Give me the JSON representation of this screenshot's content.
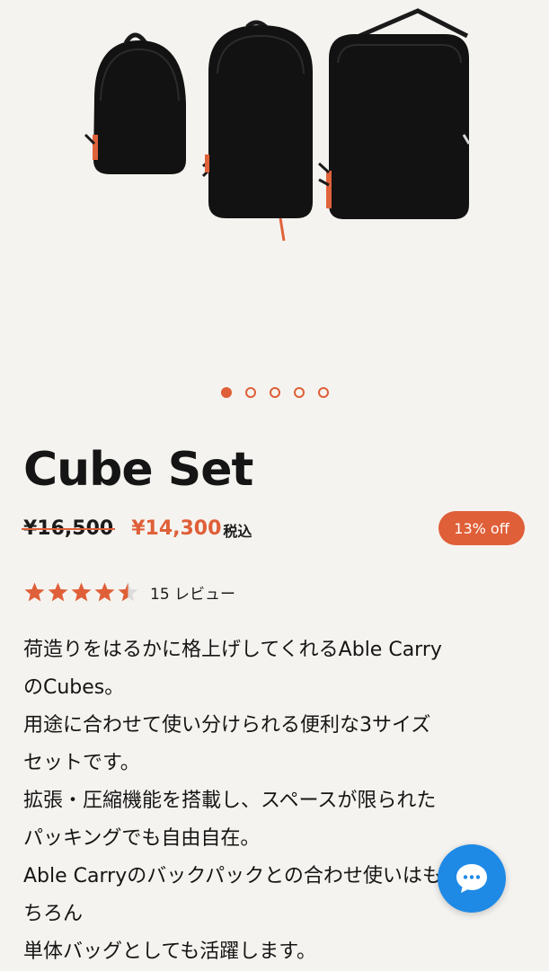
{
  "product": {
    "title": "Cube Set",
    "original_price": "¥16,500",
    "sale_price": "¥14,300",
    "tax_label": "税込",
    "discount_badge": "13% off",
    "rating": 4.5,
    "rating_max": 5,
    "review_count": "15",
    "review_label": "レビュー",
    "description": [
      "荷造りをはるかに格上げしてくれるAble Carry",
      "のCubes。",
      "用途に合わせて使い分けられる便利な3サイズ",
      "セットです。",
      "拡張・圧縮機能を搭載し、スペースが限られた",
      "パッキングでも自由自在。",
      "Able Carryのバックパックとの合わせ使いはも",
      "ちろん",
      "単体バッグとしても活躍します。"
    ]
  },
  "gallery": {
    "slide_count": 5,
    "active_index": 0
  },
  "colors": {
    "accent": "#df5f38",
    "background": "#f5f3ef",
    "chat": "#1f8ae6",
    "star_empty": "#dcdcdc"
  },
  "icons": {
    "chat": "chat-bubble-icon",
    "star": "star-icon"
  }
}
